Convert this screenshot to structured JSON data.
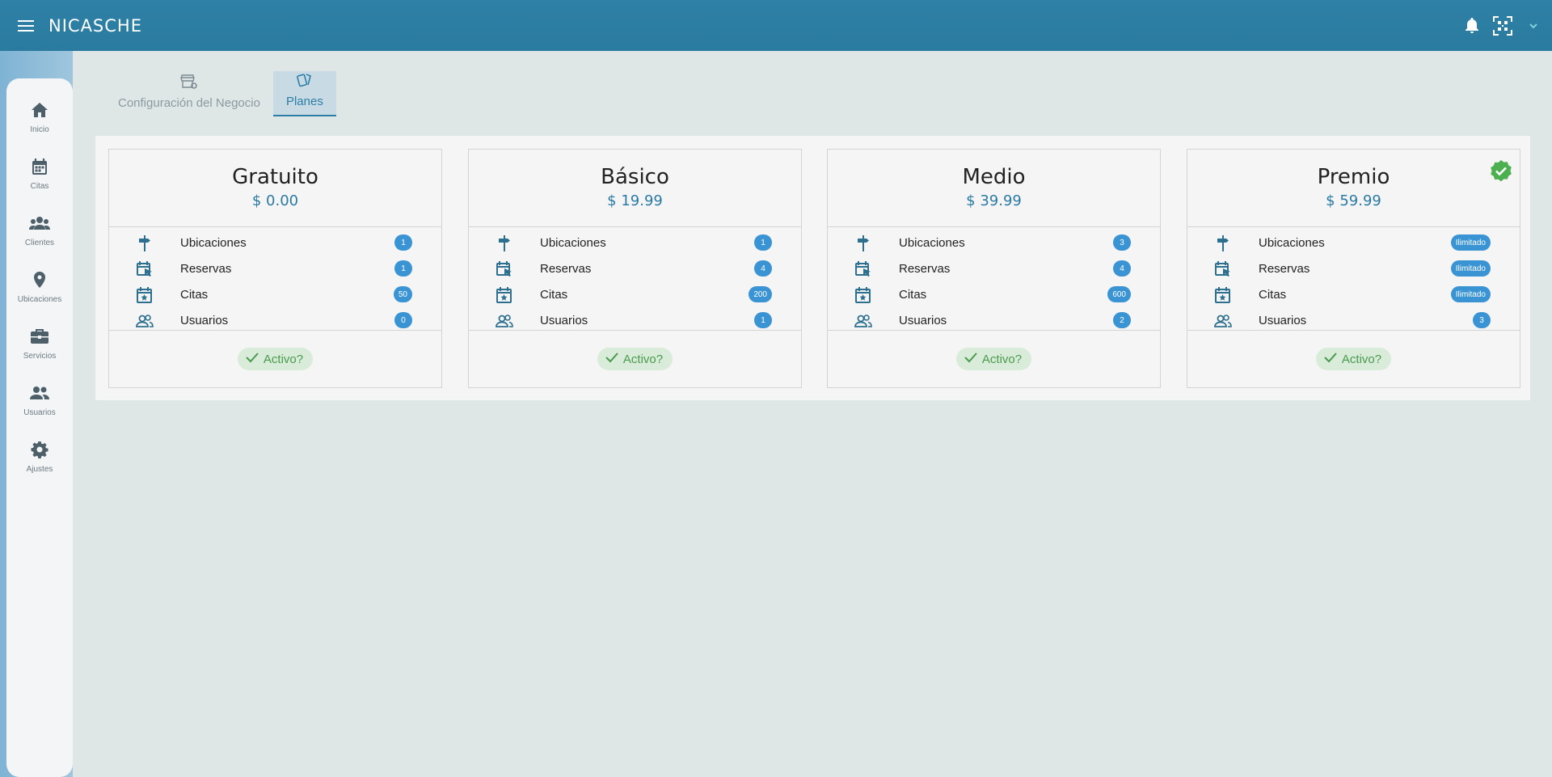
{
  "app": {
    "title": "NICASCHE"
  },
  "sidebar": {
    "items": [
      {
        "label": "Inicio",
        "icon": "home-icon"
      },
      {
        "label": "Citas",
        "icon": "calendar-icon"
      },
      {
        "label": "Clientes",
        "icon": "clients-icon"
      },
      {
        "label": "Ubicaciones",
        "icon": "location-icon"
      },
      {
        "label": "Servicios",
        "icon": "briefcase-icon"
      },
      {
        "label": "Usuarios",
        "icon": "users-icon"
      },
      {
        "label": "Ajustes",
        "icon": "gear-icon"
      }
    ]
  },
  "tabs": [
    {
      "label": "Configuración del Negocio",
      "icon": "store-settings-icon",
      "active": false
    },
    {
      "label": "Planes",
      "icon": "cards-icon",
      "active": true
    }
  ],
  "feature_labels": [
    "Ubicaciones",
    "Reservas",
    "Citas",
    "Usuarios"
  ],
  "plans": [
    {
      "name": "Gratuito",
      "price": "$ 0.00",
      "values": [
        "1",
        "1",
        "50",
        "0"
      ],
      "active_label": "Activo?",
      "current": false
    },
    {
      "name": "Básico",
      "price": "$ 19.99",
      "values": [
        "1",
        "4",
        "200",
        "1"
      ],
      "active_label": "Activo?",
      "current": false
    },
    {
      "name": "Medio",
      "price": "$ 39.99",
      "values": [
        "3",
        "4",
        "600",
        "2"
      ],
      "active_label": "Activo?",
      "current": false
    },
    {
      "name": "Premio",
      "price": "$ 59.99",
      "values": [
        "Ilimitado",
        "Ilimitado",
        "Ilimitado",
        "3"
      ],
      "active_label": "Activo?",
      "current": true
    }
  ],
  "colors": {
    "primary": "#2c7ea7",
    "badge": "#3a94d4",
    "success": "#4caf50"
  }
}
